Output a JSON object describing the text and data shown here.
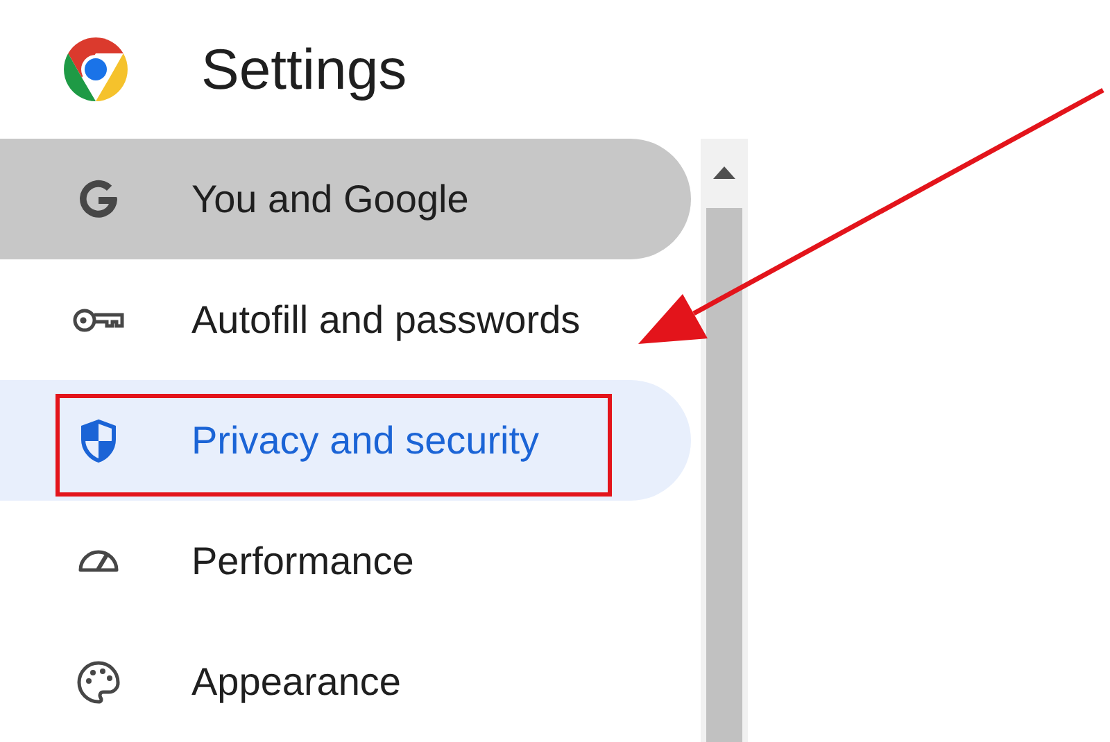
{
  "header": {
    "title": "Settings"
  },
  "sidebar": {
    "items": [
      {
        "label": "You and Google",
        "selected": false,
        "hovered": true
      },
      {
        "label": "Autofill and passwords",
        "selected": false,
        "hovered": false
      },
      {
        "label": "Privacy and security",
        "selected": true,
        "hovered": false
      },
      {
        "label": "Performance",
        "selected": false,
        "hovered": false
      },
      {
        "label": "Appearance",
        "selected": false,
        "hovered": false
      }
    ]
  },
  "annotations": {
    "frame": true,
    "arrow": true
  }
}
